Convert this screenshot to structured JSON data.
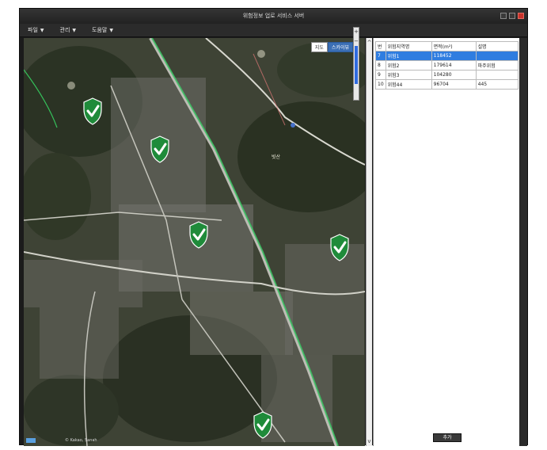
{
  "window": {
    "title": "위험정보 업로 서비스 서버"
  },
  "menu": [
    {
      "label": "파일"
    },
    {
      "label": "관리"
    },
    {
      "label": "도움말"
    }
  ],
  "map": {
    "toggle": {
      "map_label": "지도",
      "sky_label": "스카이뷰",
      "active": "sky"
    },
    "zoom": {
      "plus": "+",
      "minus": "−"
    },
    "labels": [
      "빗산"
    ],
    "attribution": "© Kakao, Sanah"
  },
  "table": {
    "columns": [
      "번",
      "위험지역명",
      "면적(m²)",
      "설명"
    ],
    "rows": [
      {
        "no": "7",
        "name": "위험1",
        "area": "118452",
        "desc": "",
        "selected": true
      },
      {
        "no": "8",
        "name": "위험2",
        "area": "179614",
        "desc": "파주위험",
        "selected": false
      },
      {
        "no": "9",
        "name": "위험3",
        "area": "104280",
        "desc": "",
        "selected": false
      },
      {
        "no": "10",
        "name": "위험44",
        "area": "96704",
        "desc": "445",
        "selected": false
      }
    ]
  },
  "panel": {
    "add_button": "추가"
  },
  "colors": {
    "accent": "#2f7de0",
    "shield": "#1f8b3a"
  }
}
